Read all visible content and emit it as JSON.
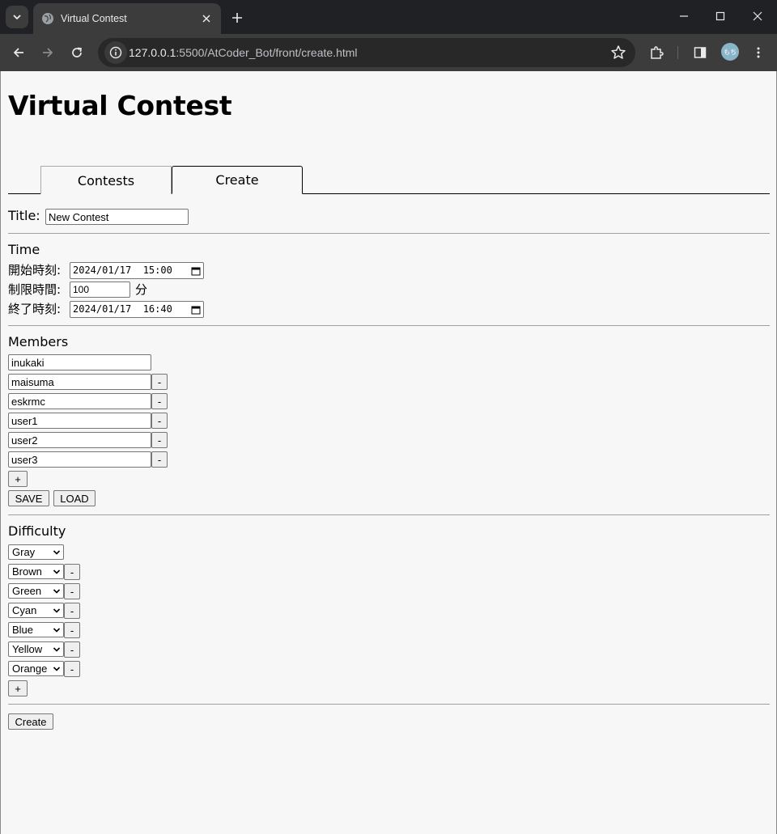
{
  "browser": {
    "tab_title": "Virtual Contest",
    "url_host": "127.0.0.1",
    "url_rest": ":5500/AtCoder_Bot/front/create.html",
    "profile_initials": "もち"
  },
  "page": {
    "title": "Virtual Contest",
    "tabs": [
      {
        "label": "Contests"
      },
      {
        "label": "Create"
      }
    ],
    "title_field": {
      "label": "Title:",
      "value": "New Contest"
    },
    "time": {
      "heading": "Time",
      "start_label": "開始時刻:",
      "start_value": "2024/01/17  15:00",
      "duration_label": "制限時間:",
      "duration_value": "100",
      "duration_unit": "分",
      "end_label": "終了時刻:",
      "end_value": "2024/01/17  16:40"
    },
    "members": {
      "heading": "Members",
      "items": [
        {
          "value": "inukaki"
        },
        {
          "value": "maisuma"
        },
        {
          "value": "eskrmc"
        },
        {
          "value": "user1"
        },
        {
          "value": "user2"
        },
        {
          "value": "user3"
        }
      ],
      "remove_label": "-",
      "add_label": "+",
      "save_label": "SAVE",
      "load_label": "LOAD"
    },
    "difficulty": {
      "heading": "Difficulty",
      "items": [
        {
          "value": "Gray"
        },
        {
          "value": "Brown"
        },
        {
          "value": "Green"
        },
        {
          "value": "Cyan"
        },
        {
          "value": "Blue"
        },
        {
          "value": "Yellow"
        },
        {
          "value": "Orange"
        }
      ],
      "remove_label": "-",
      "add_label": "+"
    },
    "create_label": "Create"
  }
}
